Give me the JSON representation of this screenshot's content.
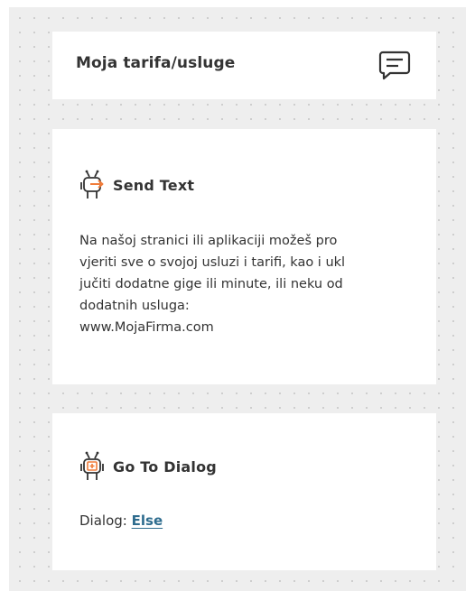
{
  "header": {
    "title": "Moja tarifa/usluge",
    "comment_icon": "comment-icon"
  },
  "send_text": {
    "icon": "robot-send-icon",
    "title": "Send Text",
    "body": "Na našoj stranici ili aplikaciji možeš pro\nvjeriti sve o svojoj usluzi i tarifi, kao i ukl\njučiti dodatne gige ili minute, ili neku od\ndodatnih usluga:\nwww.MojaFirma.com"
  },
  "go_to_dialog": {
    "icon": "robot-goto-icon",
    "title": "Go To Dialog",
    "dialog_label": "Dialog:",
    "dialog_target": "Else"
  },
  "colors": {
    "accent": "#f07c3a",
    "link": "#2e6c8e",
    "text": "#333333",
    "canvas": "#eeeeee"
  }
}
